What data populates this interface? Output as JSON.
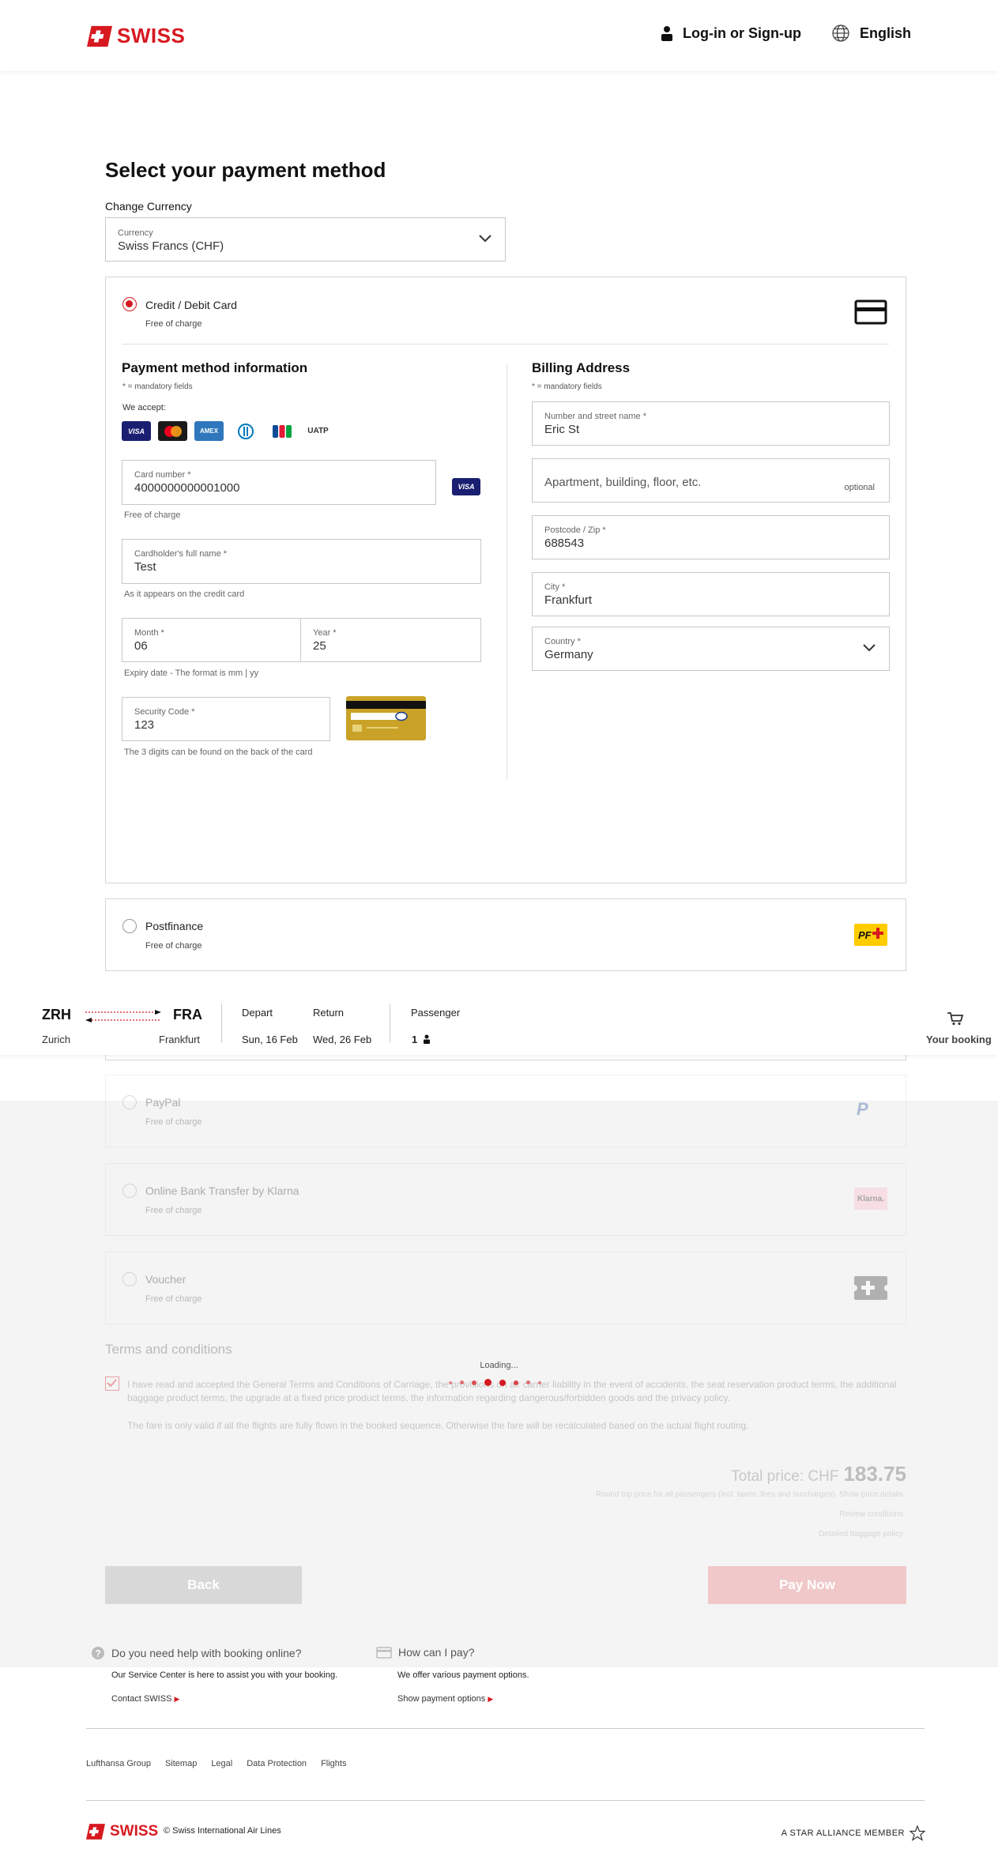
{
  "header": {
    "brand": "SWISS",
    "login_label": "Log-in or Sign-up",
    "language_label": "English"
  },
  "page": {
    "title": "Select your payment method",
    "change_currency_label": "Change Currency",
    "currency": {
      "label": "Currency",
      "value": "Swiss Francs (CHF)"
    }
  },
  "credit_card": {
    "label": "Credit / Debit Card",
    "sub": "Free of charge",
    "payment_info": {
      "title": "Payment method information",
      "mandatory": "* = mandatory fields",
      "we_accept": "We accept:",
      "logos": [
        "VISA",
        "Mastercard",
        "AMEX",
        "Diners",
        "JCB",
        "UATP"
      ],
      "card_number": {
        "label": "Card number *",
        "value": "4000000000001000",
        "hint": "Free of charge",
        "badge": "VISA"
      },
      "holder": {
        "label": "Cardholder's full name *",
        "value": "Test",
        "hint": "As it appears on the credit card"
      },
      "month": {
        "label": "Month *",
        "value": "06"
      },
      "year": {
        "label": "Year *",
        "value": "25"
      },
      "expiry_hint": "Expiry date - The format is mm | yy",
      "security": {
        "label": "Security Code *",
        "value": "123",
        "hint": "The 3 digits can be found on the back of the card"
      }
    },
    "billing": {
      "title": "Billing Address",
      "mandatory": "* = mandatory fields",
      "street": {
        "label": "Number and street name *",
        "value": "Eric St"
      },
      "apartment": {
        "placeholder": "Apartment, building, floor, etc.",
        "tag": "optional"
      },
      "postcode": {
        "label": "Postcode / Zip *",
        "value": "688543"
      },
      "city": {
        "label": "City *",
        "value": "Frankfurt"
      },
      "country": {
        "label": "Country *",
        "value": "Germany"
      }
    }
  },
  "options": [
    {
      "label": "Postfinance",
      "sub": "Free of charge",
      "icon": "PF"
    },
    {
      "label": "PayPal",
      "sub": "Free of charge",
      "icon": "P"
    },
    {
      "label": "Online Bank Transfer by Klarna",
      "sub": "Free of charge",
      "icon": "Klarna."
    },
    {
      "label": "Voucher",
      "sub": "Free of charge",
      "icon": "voucher"
    }
  ],
  "booking_bar": {
    "from_code": "ZRH",
    "from_city": "Zurich",
    "to_code": "FRA",
    "to_city": "Frankfurt",
    "depart_label": "Depart",
    "depart_date": "Sun, 16 Feb",
    "return_label": "Return",
    "return_date": "Wed, 26 Feb",
    "passenger_label": "Passenger",
    "passenger_count": "1",
    "cart_label": "Your booking"
  },
  "terms": {
    "title": "Terms and conditions",
    "text1": "I have read and accepted the General Terms and Conditions of Carriage, the provisions on air carrier liability in the event of accidents, the seat reservation product terms, the additional baggage product terms, the upgrade at a fixed price product terms, the information regarding dangerous/forbidden goods and the privacy policy.",
    "text2": "The fare is only valid if all the flights are fully flown in the booked sequence. Otherwise the fare will be recalculated based on the actual flight routing."
  },
  "price": {
    "label": "Total price: CHF",
    "amount": "183.75",
    "sub": "Round trip price for all passengers (incl. taxes, fees and surcharges). Show price details",
    "review": "Review conditions",
    "baggage": "Detailed baggage policy"
  },
  "buttons": {
    "back": "Back",
    "pay": "Pay Now"
  },
  "loading": "Loading...",
  "help": {
    "online_title": "Do you need help with booking online?",
    "online_text": "Our Service Center is here to assist you with your booking.",
    "online_link": "Contact SWISS",
    "pay_title": "How can I pay?",
    "pay_text": "We offer various payment options.",
    "pay_link": "Show payment options"
  },
  "footer": {
    "links": [
      "Lufthansa Group",
      "Sitemap",
      "Legal",
      "Data Protection",
      "Flights"
    ],
    "copyright": "© Swiss International Air Lines",
    "star": "A STAR ALLIANCE MEMBER"
  },
  "colors": {
    "brand_red": "#d71920"
  }
}
